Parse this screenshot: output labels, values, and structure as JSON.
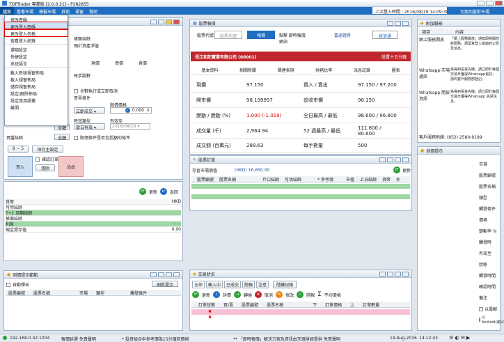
{
  "app": {
    "title": "TOPTrader 專業版 [2.0.0.21] - P282855"
  },
  "menubar": {
    "items": [
      "檔案",
      "看著市場",
      "模擬市場",
      "其他",
      "視窗",
      "幫助"
    ],
    "last_login": "上次登入時間 : 2016/08/19 14:09:30",
    "switch_label": "切換到嘉財市場"
  },
  "file_menu": {
    "items": [
      "修改密碼",
      "更改登入密碼",
      "更改登入名稱",
      "查看登入紀錄",
      "選項設定",
      "快捷設定",
      "系統語言",
      "載入新版視窗佈局",
      "載入視窗佈局",
      "儲存視窗佈局",
      "設定/解除佈局",
      "設定常用設備",
      "離開"
    ]
  },
  "order_panel": {
    "account_label": "帳面結餘",
    "net_label": "預計資產淨值",
    "cols": [
      "現價",
      "買價",
      "賣價"
    ],
    "hands_label": "每手股數",
    "all_in": "全數執行或立即取消",
    "order_type_label": "買賣條件",
    "order_type": "立即成交",
    "price_label": "限價價格",
    "price_value": "0.000",
    "expiry_type_label": "時效類型",
    "expiry_type": "當日有效",
    "expiry_label": "有效至",
    "expiry_value": "2016/08/19",
    "price_filter": "限價條件是否包括額的條件",
    "qty_label": "買盤結餘",
    "all_btn": "全額",
    "all_btn2": "全額",
    "step": "8 ~ 5",
    "clear_settings": "保存主設定",
    "confirm_order": "確認訂單",
    "buy": "買入",
    "clear": "清除",
    "sell": "沽出",
    "side_num": "8"
  },
  "portfolio": {
    "refresh": "更新",
    "back": "返回",
    "currency": "HKD",
    "rows": [
      "貨幣",
      "可用結餘",
      "T+1 到期結餘",
      "帳面結餘",
      "利息",
      "現金提存值"
    ],
    "cash_value": "0.00",
    "dash": "- - -"
  },
  "watchlist": {
    "title": "到價提示範範",
    "auto_label": "自動彈出",
    "search_btn": "刷新提示",
    "cols": [
      "股票編號",
      "股票名稱",
      "市場",
      "類型",
      "觸發條件"
    ]
  },
  "quote": {
    "title": "股票報價",
    "code_label": "股票代號",
    "code_placeholder": "股票代號",
    "trade_btn": "報價",
    "note": "點擊 即時報價網站",
    "brand": "富途證券",
    "brand2": "經濟通",
    "stock_name": "長江和記實業有限公司 (00001)",
    "board_lot": "設置十五分鐘",
    "tabs": [
      "基本資料",
      "相關新聞",
      "關連表現",
      "財務比率",
      "派息記錄",
      "圖表"
    ],
    "rows": [
      [
        "現價",
        "97.150",
        "買入 / 賣出",
        "97.150 / 97.200"
      ],
      [
        "開市價",
        "98.199997",
        "前收市價",
        "98.150"
      ],
      [
        "變動 / 變動 (%)",
        "1.000 (-1.019)",
        "全日最高 / 最低",
        "98.600 / 96.800"
      ],
      [
        "成交量 (千)",
        "2,964.94",
        "52 週最高 / 最低",
        "111.800 / 80.600"
      ],
      [
        "成交額 (百萬元)",
        "288.63",
        "每手數量",
        "500"
      ]
    ]
  },
  "holdings": {
    "title": "股票訂單",
    "subtitle": "存倉市場價值",
    "value": "(HKD) 16,650.00",
    "refresh": "更新",
    "cols": [
      "股票編號",
      "股票名稱",
      "戶口結餘",
      "可沽結餘",
      "* 參考價",
      "市值",
      "上日結餘",
      "貨幣",
      "外"
    ]
  },
  "orders": {
    "title": "交易狀況",
    "tabs": [
      "全部",
      "輸入中",
      "已成交",
      "隨報",
      "注意",
      "隱藏記錄"
    ],
    "buttons": [
      "更新",
      "詳情",
      "轉換",
      "取消",
      "修改",
      "隨報",
      "平均價格"
    ],
    "cols": [
      "訂單狀態",
      "買/賣",
      "股票編號",
      "股票名稱",
      "下",
      "訂單價格",
      "上",
      "訂單數量"
    ]
  },
  "notice": {
    "title": "附加服務",
    "cols": [
      "項目",
      "內容"
    ],
    "rows": [
      [
        "網上服務開放",
        "「網上服務開放」通知即將開放新服務，請留意登入版面的公告及消息。"
      ],
      [
        "Whatsapp 市場通訊",
        "為得到投資先機，請立即於每個交易日獲得Whatsapp資訊，請向客戶服務部登記。"
      ],
      [
        "Whatsapp 開放資訊",
        "為得到投資先機，請立即於每個交易日獲得Whatsapp 資訊信息。"
      ]
    ],
    "hotline": "客戶服務熱線: (852) 2580-9199"
  },
  "right_panel": {
    "title": "到價提示",
    "items": [
      "市場",
      "股票編號",
      "股票名稱",
      "類型",
      "觸發條件",
      "價格",
      "變動率 %",
      "觸發時",
      "有效至",
      "狀態",
      "觸發時間",
      "確認時間",
      "備注"
    ],
    "checks": [
      "以電郵",
      "以Android(或)iOS"
    ]
  },
  "status": {
    "ip": "192.168.0.42:1004",
    "delay": "報價延遲 免責聲明",
    "msg1": "* 投資組合中參考價為15分鐘前價格",
    "msg2": "** 「即時報價」解決方案及資訊由天滙財經提供 免責聲明",
    "date": "19-Aug-2016",
    "time": "14:12:43"
  }
}
